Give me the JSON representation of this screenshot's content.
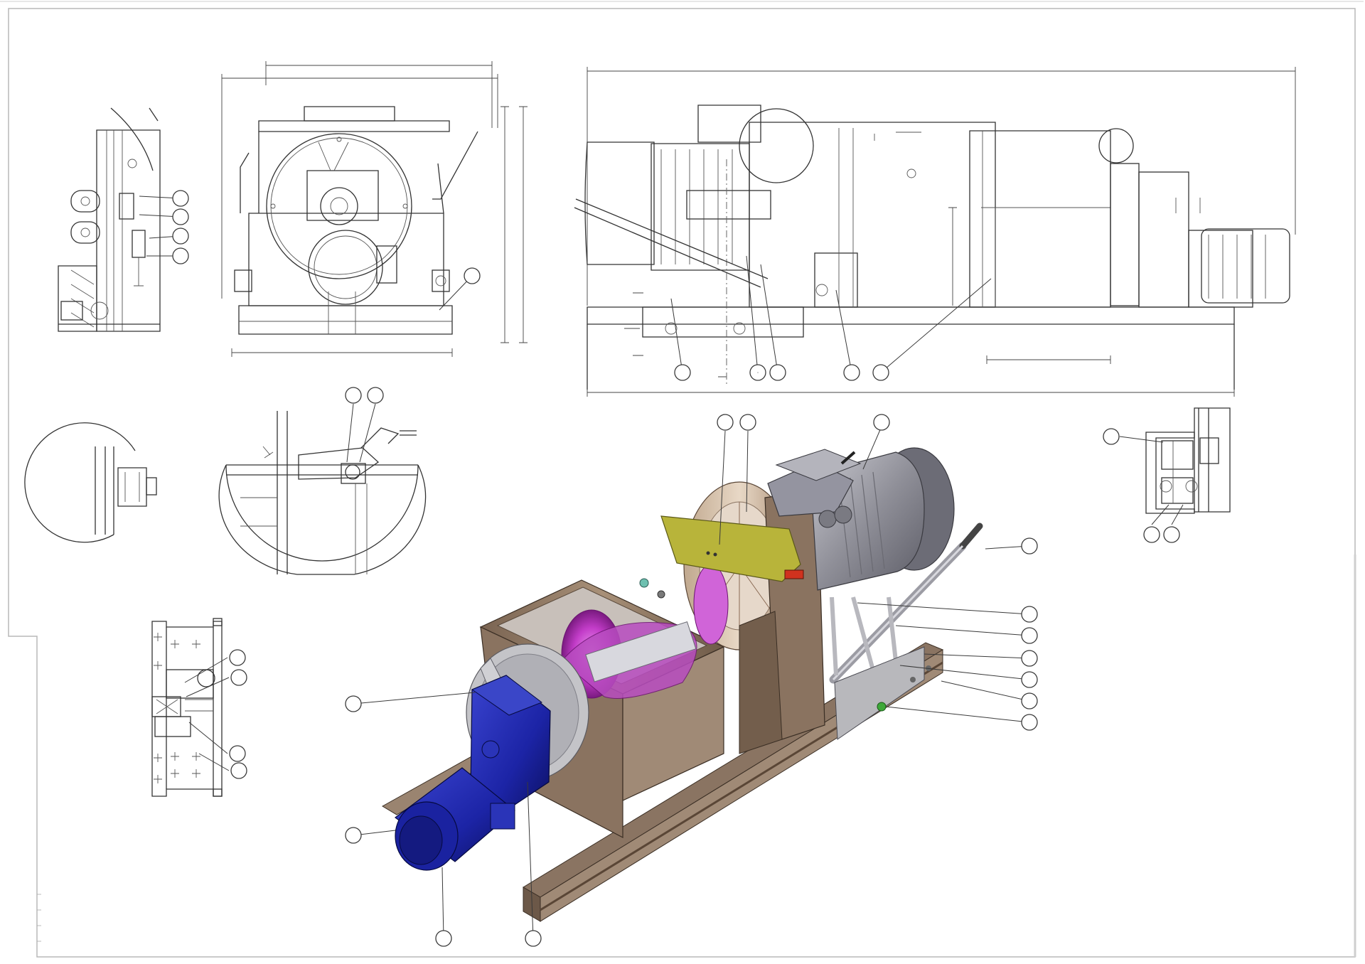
{
  "drawing": {
    "kind": "technical assembly drawing",
    "views": [
      "detail-side-left",
      "end-view",
      "side-elevation",
      "detail-circle-a",
      "detail-latch",
      "detail-bracket-right",
      "detail-seal",
      "isometric-assembly"
    ],
    "balloon_count": 42,
    "balloon_labels_visible": false
  },
  "colors": {
    "paper": "#ffffff",
    "line": "#333333",
    "frame": "#b8b8b8",
    "motor_grey": "#8f8f98",
    "gear_motor_blue": "#1c24a6",
    "housing_bronze": "#9a8470",
    "guard_yellow": "#b8b43a",
    "auger_magenta": "#c23cc8",
    "grease_green": "#3ea83a",
    "red_accent": "#d0321e"
  }
}
